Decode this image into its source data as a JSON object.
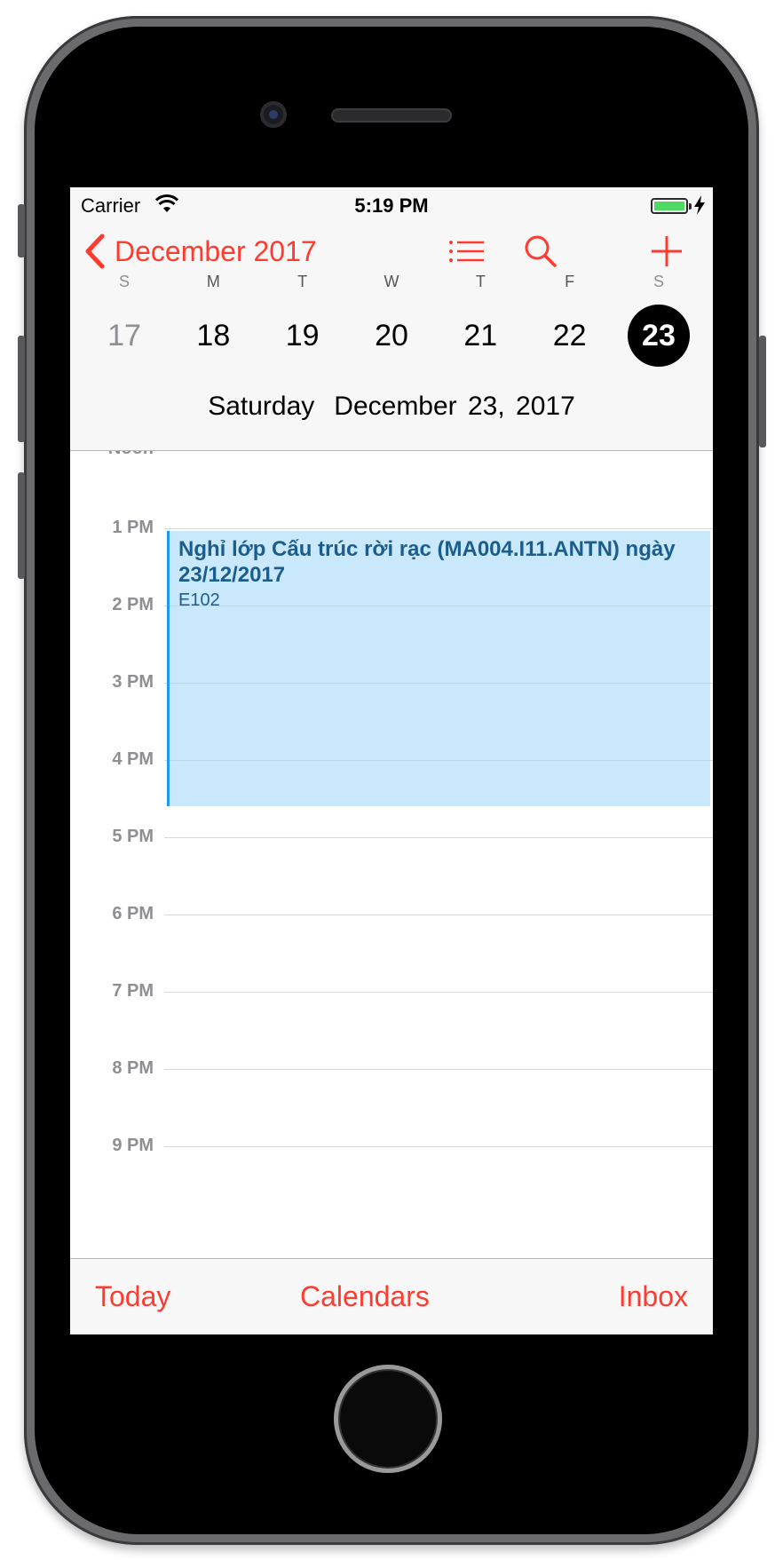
{
  "status_bar": {
    "carrier": "Carrier",
    "time": "5:19 PM"
  },
  "nav": {
    "back_label": "December 2017",
    "icons": [
      "list-icon",
      "search-icon",
      "add-icon"
    ]
  },
  "week": {
    "weekdays": [
      "S",
      "M",
      "T",
      "W",
      "T",
      "F",
      "S"
    ],
    "dates": [
      "17",
      "18",
      "19",
      "20",
      "21",
      "22",
      "23"
    ],
    "selected_index": 6
  },
  "selected_day": {
    "weekday": "Saturday",
    "date": "December 23, 2017"
  },
  "timeline": {
    "hours": [
      "Noon",
      "1 PM",
      "2 PM",
      "3 PM",
      "4 PM",
      "5 PM",
      "6 PM",
      "7 PM",
      "8 PM",
      "9 PM"
    ]
  },
  "event": {
    "title": "Nghỉ lớp Cấu trúc rời rạc (MA004.I11.ANTN) ngày 23/12/2017",
    "location": "E102",
    "color": "#1e9bf0"
  },
  "tab_bar": {
    "today": "Today",
    "calendars": "Calendars",
    "inbox": "Inbox"
  },
  "colors": {
    "accent": "#ff3b30",
    "event_fill": "#c9e9fb",
    "battery": "#4cd964"
  }
}
